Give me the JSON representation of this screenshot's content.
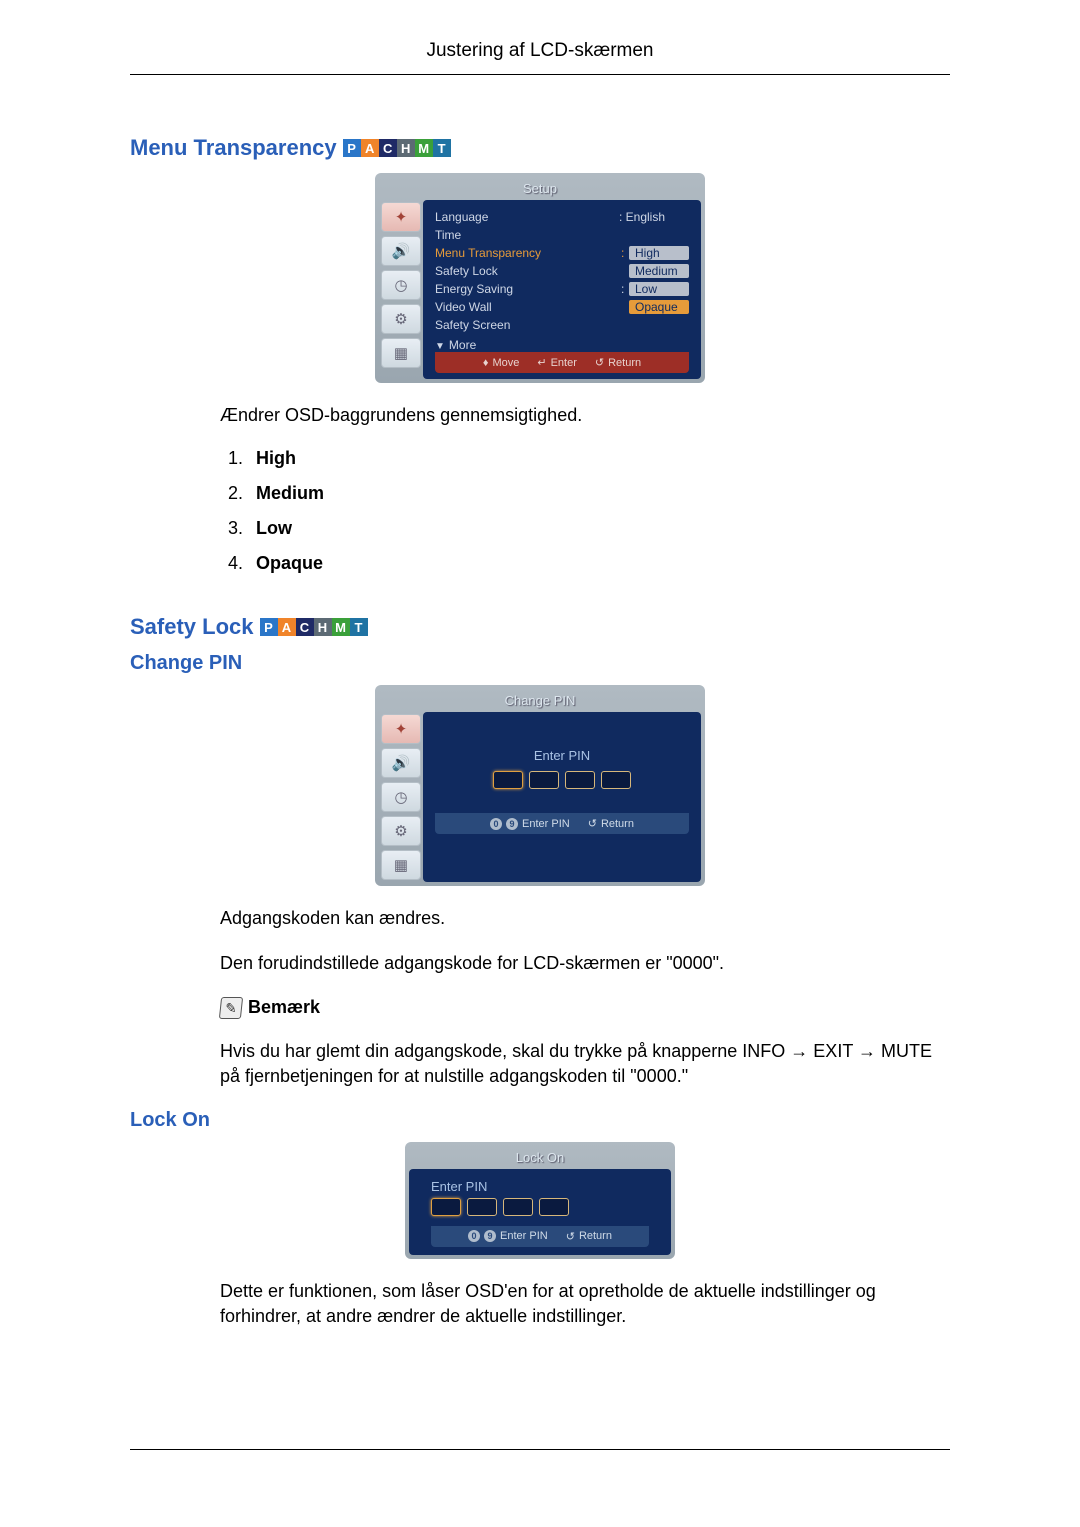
{
  "page_header": "Justering af LCD-skærmen",
  "badges": [
    "P",
    "A",
    "C",
    "H",
    "M",
    "T"
  ],
  "section1": {
    "heading": "Menu Transparency",
    "osd": {
      "title": "Setup",
      "rows": {
        "language_label": "Language",
        "language_value": ": English",
        "time_label": "Time",
        "menu_transparency_label": "Menu Transparency",
        "menu_transparency_sep": ":",
        "safety_lock_label": "Safety Lock",
        "energy_saving_label": "Energy Saving",
        "energy_saving_sep": ":",
        "video_wall_label": "Video Wall",
        "safety_screen_label": "Safety Screen"
      },
      "options": {
        "high": "High",
        "medium": "Medium",
        "low": "Low",
        "opaque": "Opaque"
      },
      "more": "More",
      "footer": {
        "move": "Move",
        "enter": "Enter",
        "return": "Return"
      }
    },
    "body": "Ændrer OSD-baggrundens gennemsigtighed.",
    "list": [
      "High",
      "Medium",
      "Low",
      "Opaque"
    ]
  },
  "section2": {
    "heading": "Safety Lock",
    "sub1": {
      "heading": "Change PIN",
      "osd_title": "Change PIN",
      "enter_pin": "Enter PIN",
      "footer_enter_pin": "Enter PIN",
      "footer_return": "Return",
      "body1": "Adgangskoden kan ændres.",
      "body2": "Den forudindstillede adgangskode for LCD-skærmen er \"0000\".",
      "note_label": "Bemærk",
      "note_text": "Hvis du har glemt din adgangskode, skal du trykke på knapperne INFO → EXIT → MUTE på fjernbetjeningen for at nulstille adgangskoden til \"0000.\""
    },
    "sub2": {
      "heading": "Lock On",
      "osd_title": "Lock On",
      "enter_pin": "Enter PIN",
      "footer_enter_pin": "Enter PIN",
      "footer_return": "Return",
      "body": "Dette er funktionen, som låser OSD'en for at opretholde de aktuelle indstillinger og forhindrer, at andre ændrer de aktuelle indstillinger."
    }
  },
  "footer_nums": {
    "0": "0",
    "9": "9"
  }
}
